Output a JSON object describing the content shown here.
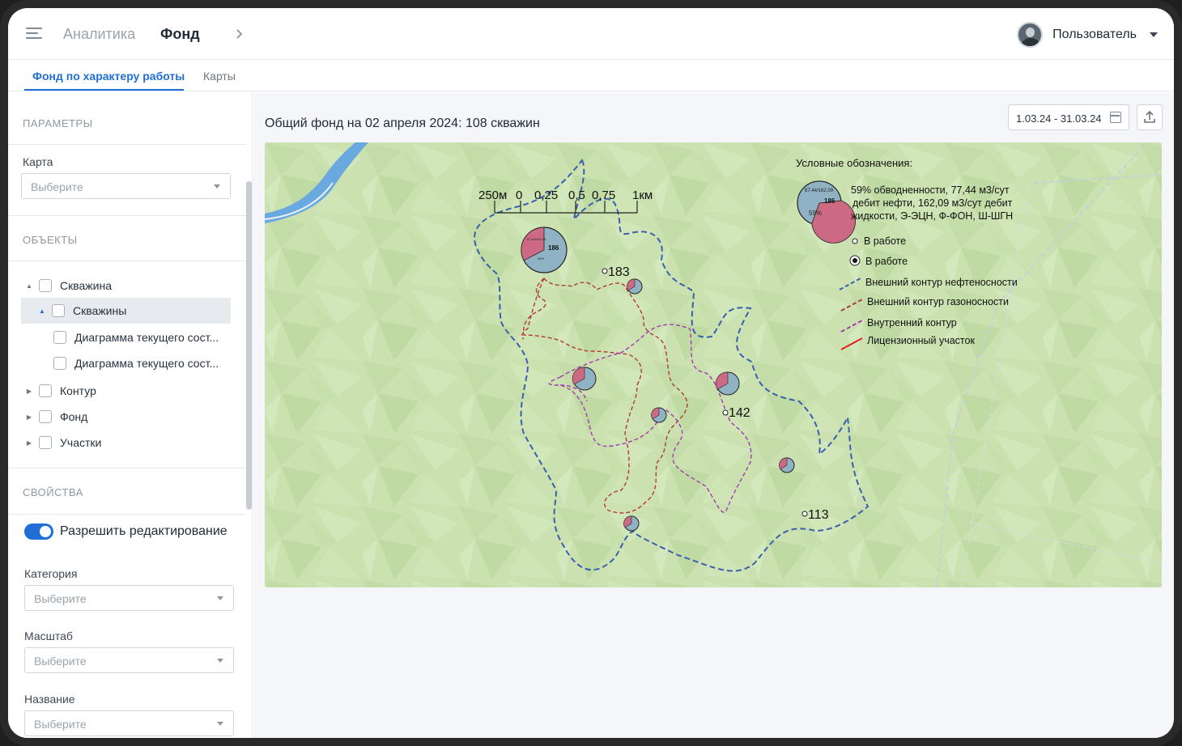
{
  "header": {
    "crumb_analytics": "Аналитика",
    "crumb_fund": "Фонд",
    "user_name": "Пользователь"
  },
  "tabs": [
    {
      "label": "Фонд по характеру работы",
      "active": true
    },
    {
      "label": "Карты",
      "active": false
    }
  ],
  "sidebar": {
    "params_title": "ПАРАМЕТРЫ",
    "map_label": "Карта",
    "map_placeholder": "Выберите",
    "objects_title": "ОБЪЕКТЫ",
    "tree": [
      {
        "label": "Скважина",
        "expanded": true
      },
      {
        "label": "Скважины",
        "expanded": true,
        "selected": true
      },
      {
        "label": "Диаграмма текущего сост..."
      },
      {
        "label": "Диаграмма текущего сост..."
      },
      {
        "label": "Контур",
        "expanded": false
      },
      {
        "label": "Фонд",
        "expanded": false
      },
      {
        "label": "Участки",
        "expanded": false
      }
    ],
    "props_title": "СВОЙСТВА",
    "allow_edit_label": "Разрешить редактирование",
    "allow_edit_on": true,
    "category_label": "Категория",
    "category_placeholder": "Выберите",
    "scale_label": "Масштаб",
    "scale_placeholder": "Выберите",
    "name_label": "Название",
    "name_placeholder": "Выберите"
  },
  "main": {
    "title": "Общий фонд на 02 апреля 2024: 108 скважин",
    "date_range": "1.03.24 - 31.03.24"
  },
  "map": {
    "scale_labels": [
      "250м",
      "0",
      "0,25",
      "0,5",
      "0,75",
      "1км"
    ],
    "wells": [
      {
        "label": "183"
      },
      {
        "label": "142"
      },
      {
        "label": "113"
      }
    ],
    "big_pie": {
      "value": "186",
      "top_text": "67,44/162,09",
      "pct": "59%"
    },
    "legend": {
      "title": "Условные обозначения:",
      "pie_text_line1": "59% обводненности,  77,44 м3/сут",
      "pie_text_line2": "дебит нефти, 162,09 м3/сут дебит",
      "pie_text_line3": "жидкости, Э-ЭЦН, Ф-ФОН, Ш-ШГН",
      "pie_value": "186",
      "pie_top": "67,44/162,09",
      "pie_pct": "59%",
      "in_work_1": "В работе",
      "in_work_2": "В работе",
      "oil_contour": "Внешний контур нефтеносности",
      "gas_contour": "Внешний контур газоносности",
      "inner_contour": "Внутренний контур",
      "license": "Лицензионный участок"
    },
    "colors": {
      "oil": "#3a5fb0",
      "gas": "#b03a3a",
      "inner": "#a23bb3",
      "license": "#e02020",
      "pie_pink": "#cc6a84",
      "pie_blue": "#8fb3c4"
    }
  }
}
